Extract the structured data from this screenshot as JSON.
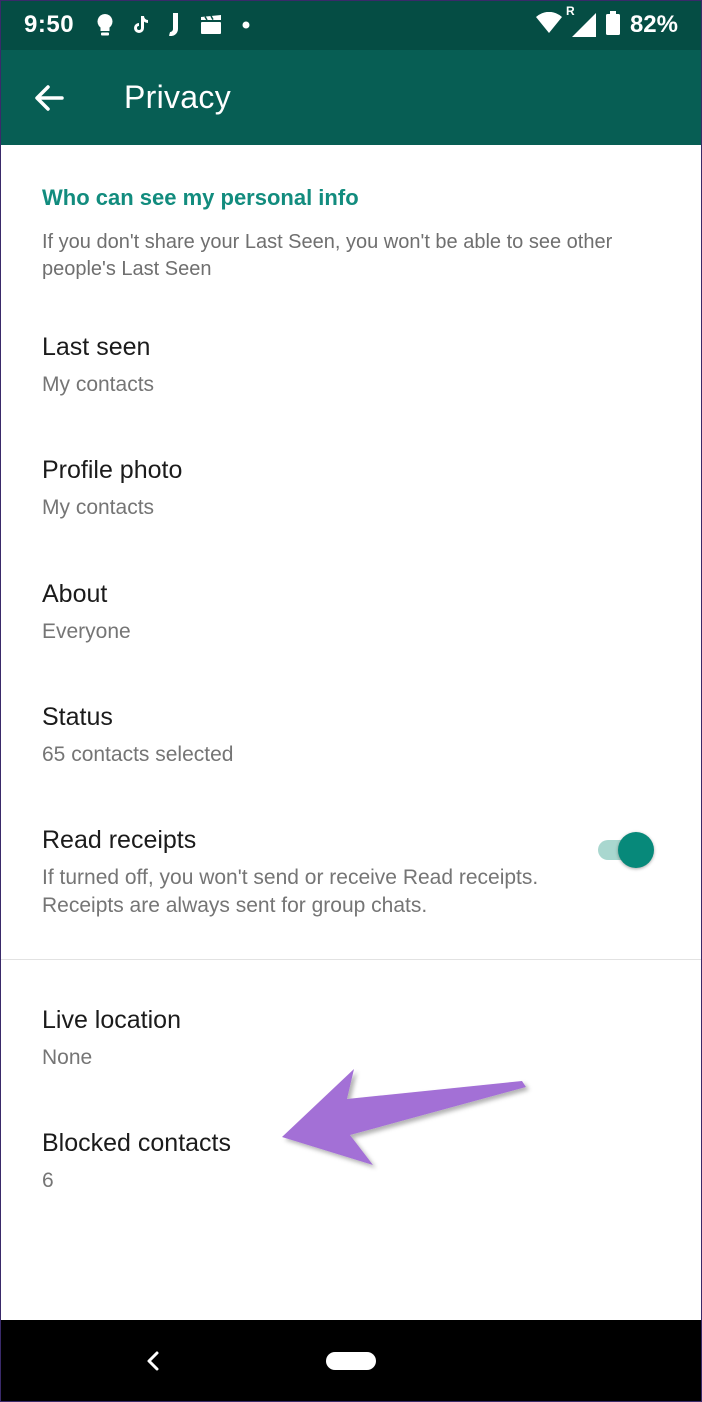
{
  "status_bar": {
    "time": "9:50",
    "battery_percent": "82%",
    "roaming_indicator": "R",
    "notification_icons": [
      "lightbulb-icon",
      "tiktok-icon",
      "j-app-icon",
      "clapperboard-icon",
      "dot-icon"
    ],
    "battery_level": 0.82
  },
  "app_bar": {
    "title": "Privacy",
    "back_icon": "arrow-left-icon"
  },
  "section": {
    "header": "Who can see my personal info",
    "description": "If you don't share your Last Seen, you won't be able to see other people's Last Seen"
  },
  "items": [
    {
      "title": "Last seen",
      "value": "My contacts"
    },
    {
      "title": "Profile photo",
      "value": "My contacts"
    },
    {
      "title": "About",
      "value": "Everyone"
    },
    {
      "title": "Status",
      "value": "65 contacts selected"
    },
    {
      "title": "Read receipts",
      "value": "If turned off, you won't send or receive Read receipts. Receipts are always sent for group chats.",
      "toggle_on": true
    },
    {
      "title": "Live location",
      "value": "None"
    },
    {
      "title": "Blocked contacts",
      "value": "6"
    }
  ],
  "colors": {
    "status_bar": "#054d44",
    "app_bar": "#075e54",
    "accent": "#128c7e",
    "toggle_thumb": "#07897a",
    "toggle_track": "#a9d7cf",
    "annotation_arrow": "#a36fd6"
  },
  "nav_bar": {
    "back_icon": "nav-back-icon",
    "home_icon": "home-pill-icon"
  }
}
